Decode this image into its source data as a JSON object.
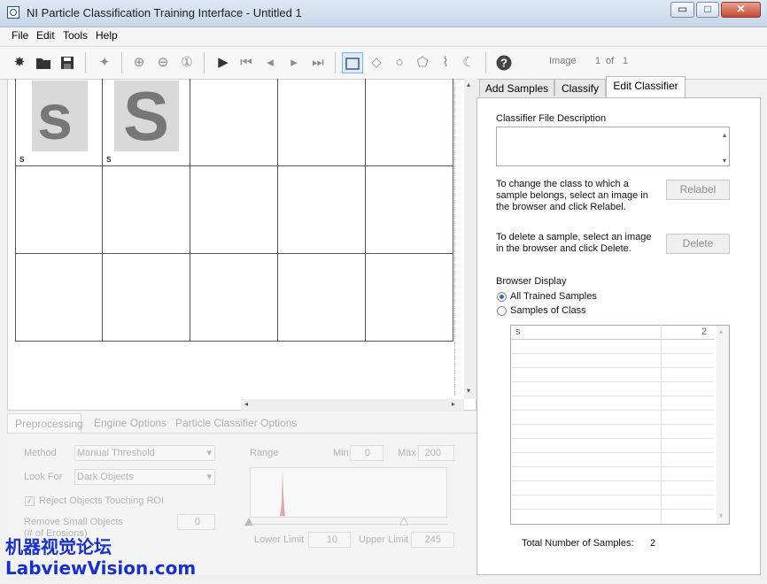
{
  "window": {
    "title": "NI Particle Classification Training Interface - Untitled 1",
    "minimize": "▭",
    "maximize": "□",
    "close": "✕"
  },
  "menu": [
    "File",
    "Edit",
    "Tools",
    "Help"
  ],
  "toolbar": {
    "image_label": "Image",
    "image_index": "1",
    "of_label": "of",
    "image_total": "1"
  },
  "browser": {
    "samples": [
      {
        "letter": "s",
        "label": "s"
      },
      {
        "letter": "S",
        "label": "s"
      }
    ],
    "scroll_up": "▴",
    "scroll_down": "▾",
    "scroll_left": "◂",
    "scroll_right": "▸"
  },
  "bottom_panel": {
    "tabs": [
      "Preprocessing",
      "Engine Options",
      "Particle Classifier Options"
    ],
    "method_label": "Method",
    "method_value": "Manual Threshold",
    "look_for_label": "Look For",
    "look_for_value": "Dark Objects",
    "reject_label": "Reject Objects Touching ROI",
    "remove_small_label": "Remove Small Objects",
    "erosions_label": "(# of Erosions)",
    "erosions_value": "0",
    "range_label": "Range",
    "min_label": "Min",
    "min_value": "0",
    "max_label": "Max",
    "max_value": "200",
    "lower_limit_label": "Lower Limit",
    "lower_limit_value": "10",
    "upper_limit_label": "Upper Limit",
    "upper_limit_value": "245"
  },
  "right_panel": {
    "tabs": [
      "Add Samples",
      "Classify",
      "Edit Classifier"
    ],
    "description_label": "Classifier File Description",
    "relabel_text": "To change the class to which a sample belongs, select an image in the browser and click Relabel.",
    "relabel_button": "Relabel",
    "delete_text": "To delete a sample, select an image in the browser and click Delete.",
    "delete_button": "Delete",
    "browser_display_label": "Browser Display",
    "radio_all": "All Trained Samples",
    "radio_class": "Samples of Class",
    "table_rows": [
      {
        "class": "s",
        "count": "2"
      }
    ],
    "total_label": "Total Number of Samples:",
    "total_value": "2"
  },
  "watermark": {
    "line1": "机器视觉论坛",
    "line2": "LabviewVision.com"
  }
}
